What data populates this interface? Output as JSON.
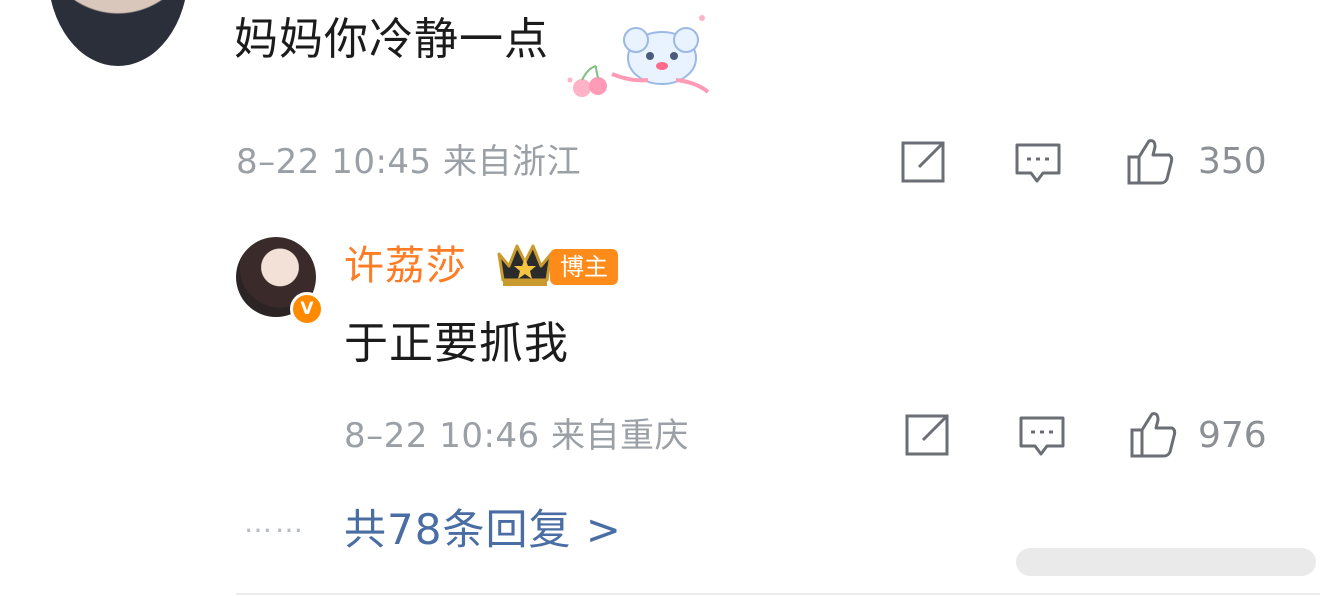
{
  "comment": {
    "text": "妈妈你冷静一点",
    "meta": "8–22 10:45 来自浙江",
    "like_count": "350"
  },
  "reply": {
    "name": "许荔莎",
    "badge": "博主",
    "text": "于正要抓我",
    "meta": "8–22 10:46 来自重庆",
    "like_count": "976"
  },
  "replies_link": {
    "dots": "……",
    "label": "共78条回复 >"
  },
  "colors": {
    "name_orange": "#ff7b24",
    "link_blue": "#4a6ea3",
    "meta_gray": "#9aa0a6"
  },
  "icons": [
    "share-icon",
    "comment-icon",
    "like-icon",
    "verified-icon",
    "crown-icon",
    "sticker"
  ]
}
